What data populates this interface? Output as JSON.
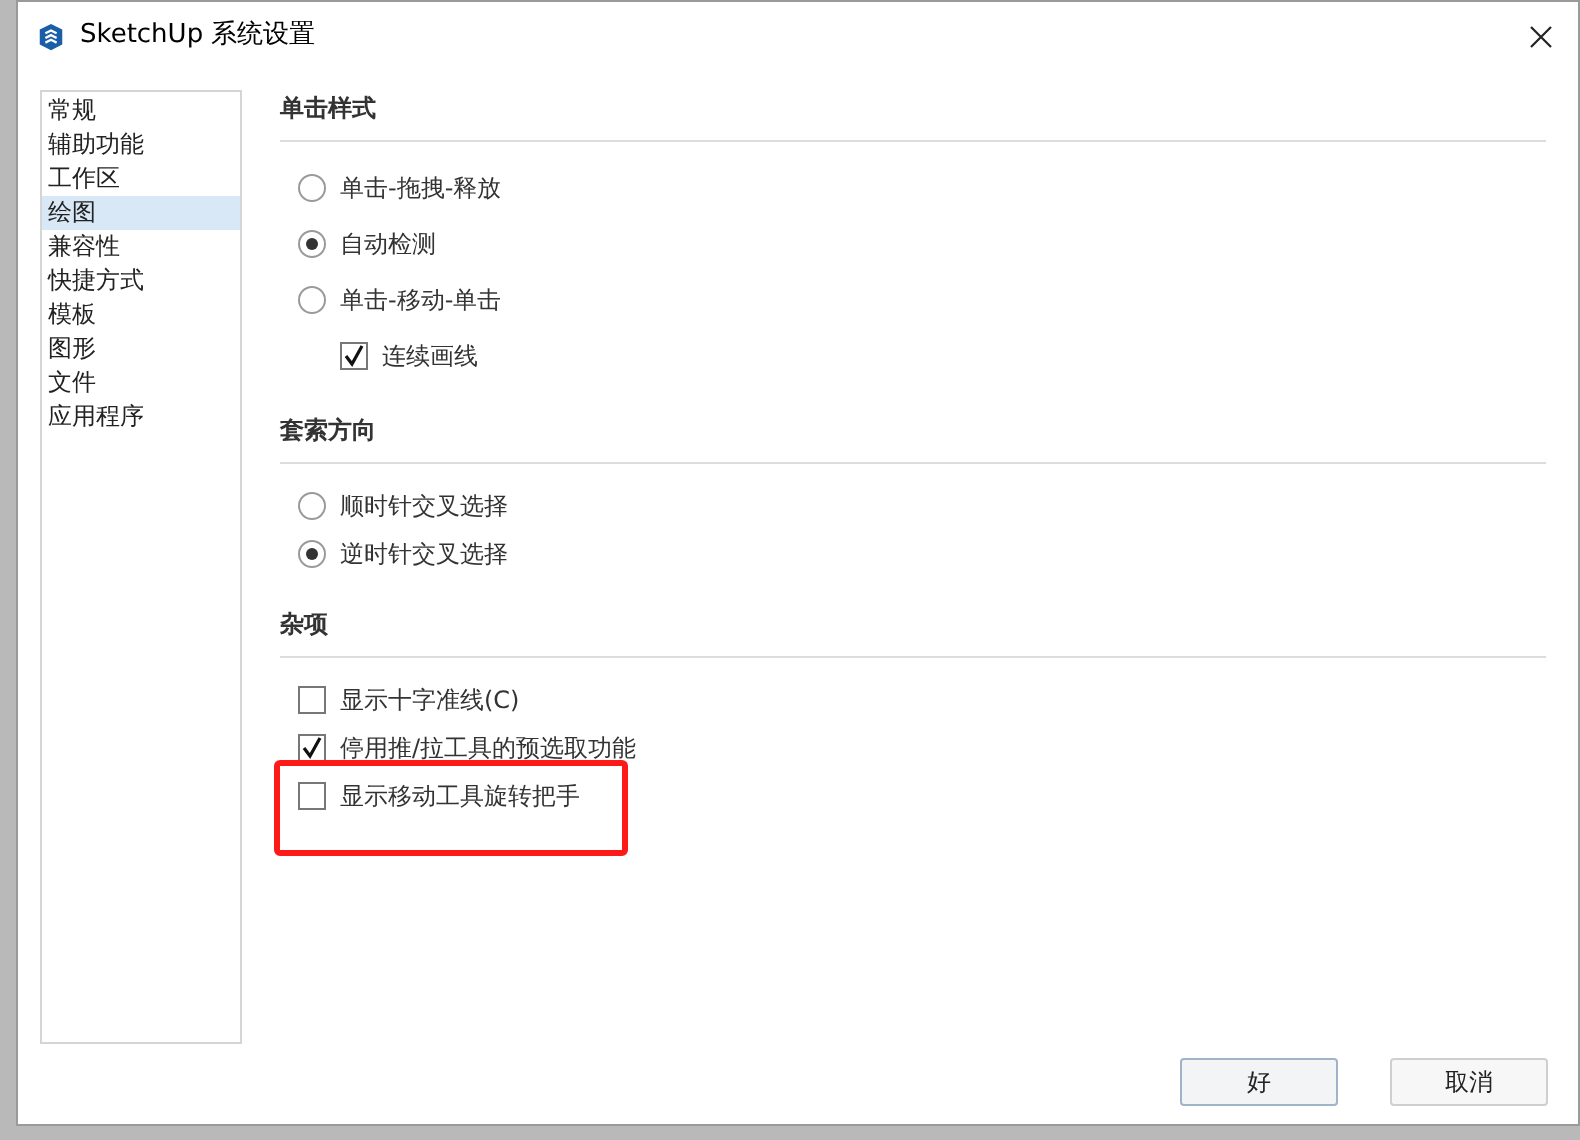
{
  "window": {
    "title": "SketchUp 系统设置"
  },
  "sidebar": {
    "items": [
      {
        "label": "常规",
        "selected": false
      },
      {
        "label": "辅助功能",
        "selected": false
      },
      {
        "label": "工作区",
        "selected": false
      },
      {
        "label": "绘图",
        "selected": true
      },
      {
        "label": "兼容性",
        "selected": false
      },
      {
        "label": "快捷方式",
        "selected": false
      },
      {
        "label": "模板",
        "selected": false
      },
      {
        "label": "图形",
        "selected": false
      },
      {
        "label": "文件",
        "selected": false
      },
      {
        "label": "应用程序",
        "selected": false
      }
    ]
  },
  "sections": [
    {
      "title": "单击样式",
      "items": [
        {
          "kind": "radio",
          "label": "单击-拖拽-释放",
          "selected": false
        },
        {
          "kind": "radio",
          "label": "自动检测",
          "selected": true
        },
        {
          "kind": "radio",
          "label": "单击-移动-单击",
          "selected": false
        },
        {
          "kind": "subcheck",
          "label": "连续画线",
          "checked": true
        }
      ]
    },
    {
      "title": "套索方向",
      "items": [
        {
          "kind": "radio",
          "label": "顺时针交叉选择",
          "selected": false
        },
        {
          "kind": "radio",
          "label": "逆时针交叉选择",
          "selected": true
        }
      ]
    },
    {
      "title": "杂项",
      "items": [
        {
          "kind": "check",
          "label": "显示十字准线(C)",
          "checked": false,
          "highlighted": false
        },
        {
          "kind": "check",
          "label": "停用推/拉工具的预选取功能",
          "checked": true,
          "highlighted": false
        },
        {
          "kind": "check",
          "label": "显示移动工具旋转把手",
          "checked": false,
          "highlighted": true
        }
      ]
    }
  ],
  "buttons": [
    {
      "label": "好",
      "kind": "default"
    },
    {
      "label": "取消",
      "kind": "normal"
    }
  ]
}
